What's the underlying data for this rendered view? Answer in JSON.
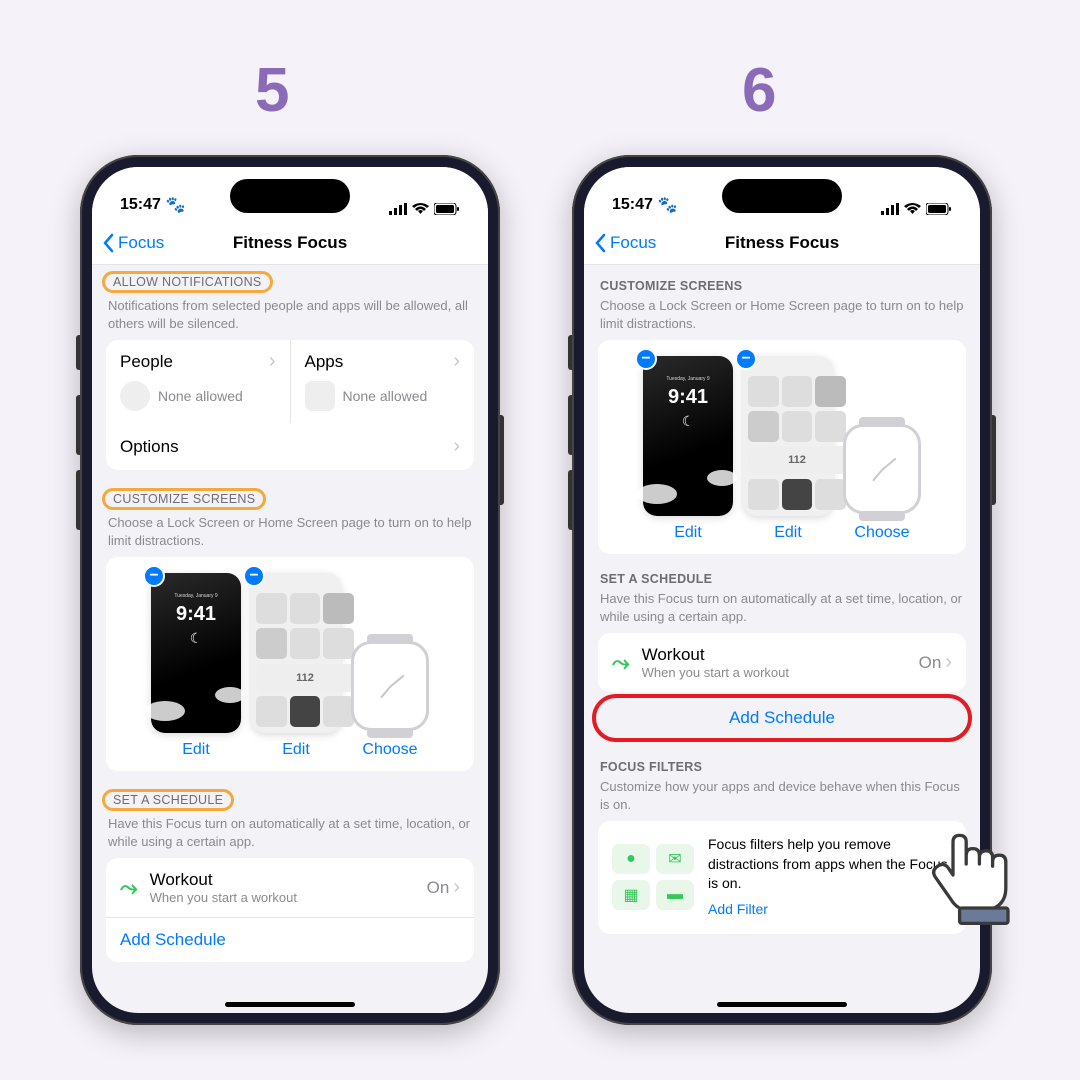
{
  "steps": {
    "left": "5",
    "right": "6"
  },
  "status": {
    "time": "15:47",
    "emoji": "🐾"
  },
  "nav": {
    "back": "Focus",
    "title": "Fitness Focus"
  },
  "allow": {
    "header": "ALLOW NOTIFICATIONS",
    "desc": "Notifications from selected people and apps will be allowed, all others will be silenced.",
    "people": "People",
    "apps": "Apps",
    "none": "None allowed",
    "options": "Options"
  },
  "customize": {
    "header": "CUSTOMIZE SCREENS",
    "desc": "Choose a Lock Screen or Home Screen page to turn on to help limit distractions.",
    "edit": "Edit",
    "choose": "Choose",
    "lock_time": "9:41",
    "lock_date": "Tuesday, January 9"
  },
  "schedule": {
    "header": "SET A SCHEDULE",
    "desc": "Have this Focus turn on automatically at a set time, location, or while using a certain app.",
    "workout": "Workout",
    "workout_sub": "When you start a workout",
    "on": "On",
    "add": "Add Schedule"
  },
  "filters": {
    "header": "FOCUS FILTERS",
    "desc": "Customize how your apps and device behave when this Focus is on.",
    "body": "Focus filters help you remove distractions from apps when the Focus is on.",
    "link": "Add Filter"
  },
  "colors": {
    "accent": "#007aff",
    "highlight": "#f4a93a",
    "callout": "#e31b23",
    "step_num": "#8b6bb8"
  }
}
